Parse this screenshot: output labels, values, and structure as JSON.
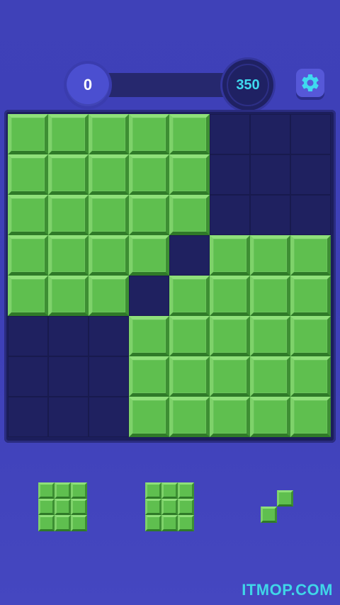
{
  "header": {
    "score": "0",
    "best_score": "350",
    "settings_icon": "gear-icon"
  },
  "colors": {
    "background": "#3f41b8",
    "board": "#1c1e5c",
    "block": "#5fbf4f",
    "best_text": "#3fd9ef",
    "watermark": "#3fd6e8"
  },
  "board": {
    "rows": 8,
    "cols": 8,
    "cells": [
      [
        1,
        1,
        1,
        1,
        1,
        0,
        0,
        0
      ],
      [
        1,
        1,
        1,
        1,
        1,
        0,
        0,
        0
      ],
      [
        1,
        1,
        1,
        1,
        1,
        0,
        0,
        0
      ],
      [
        1,
        1,
        1,
        1,
        0,
        1,
        1,
        1
      ],
      [
        1,
        1,
        1,
        0,
        1,
        1,
        1,
        1
      ],
      [
        0,
        0,
        0,
        1,
        1,
        1,
        1,
        1
      ],
      [
        0,
        0,
        0,
        1,
        1,
        1,
        1,
        1
      ],
      [
        0,
        0,
        0,
        1,
        1,
        1,
        1,
        1
      ]
    ]
  },
  "tray": {
    "pieces": [
      {
        "shape": [
          [
            1,
            1,
            1
          ],
          [
            1,
            1,
            1
          ],
          [
            1,
            1,
            1
          ]
        ]
      },
      {
        "shape": [
          [
            1,
            1,
            1
          ],
          [
            1,
            1,
            1
          ],
          [
            1,
            1,
            1
          ]
        ]
      },
      {
        "shape": [
          [
            0,
            0,
            0
          ],
          [
            0,
            1,
            0
          ],
          [
            1,
            0,
            0
          ]
        ]
      }
    ]
  },
  "watermark": "ITMOP.COM"
}
